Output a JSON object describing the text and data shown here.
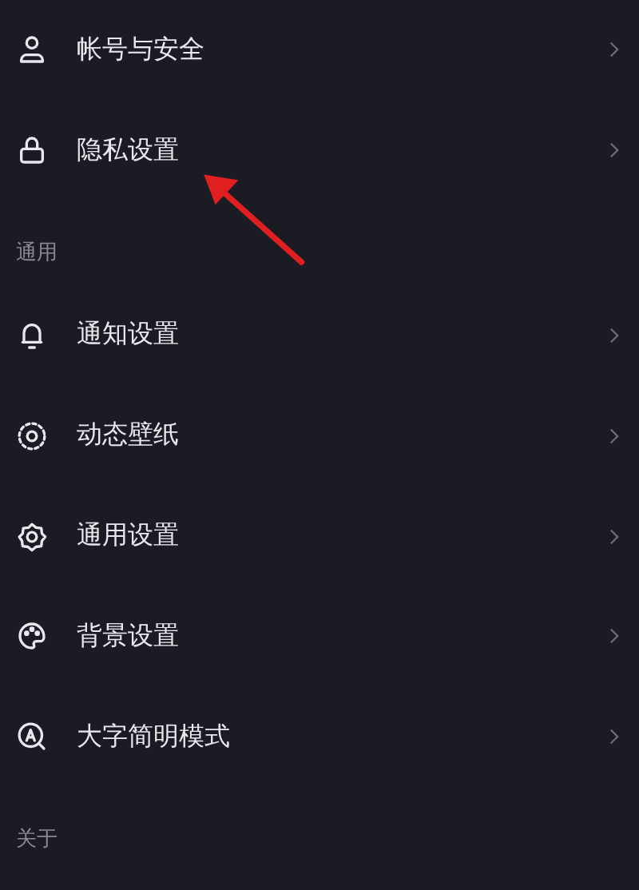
{
  "sections": [
    {
      "items": [
        {
          "kind": "account",
          "label": "帐号与安全"
        },
        {
          "kind": "privacy",
          "label": "隐私设置"
        }
      ]
    },
    {
      "title": "通用",
      "items": [
        {
          "kind": "notify",
          "label": "通知设置"
        },
        {
          "kind": "wallpaper",
          "label": "动态壁纸"
        },
        {
          "kind": "general",
          "label": "通用设置"
        },
        {
          "kind": "background",
          "label": "背景设置"
        },
        {
          "kind": "largefont",
          "label": "大字简明模式"
        }
      ]
    },
    {
      "title": "关于"
    }
  ]
}
